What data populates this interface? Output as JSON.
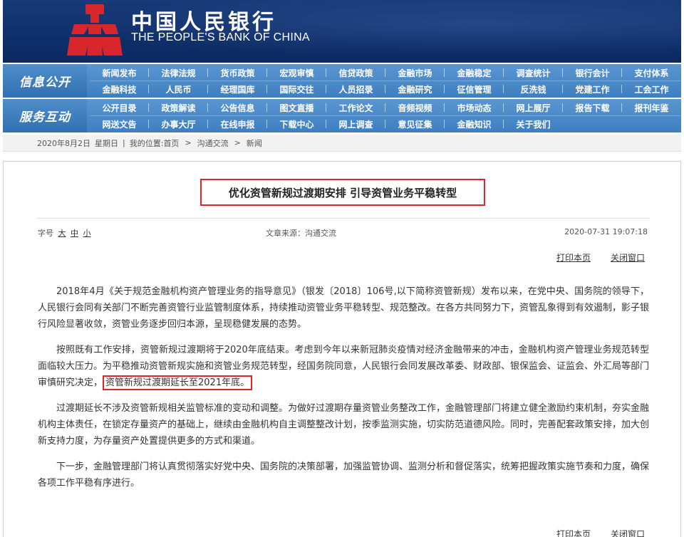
{
  "brand": {
    "name_cn": "中国人民银行",
    "name_en": "THE PEOPLE'S BANK OF CHINA",
    "emblem_color": "#d8262d"
  },
  "nav": [
    {
      "heading": "信息公开",
      "rows": [
        [
          "新闻发布",
          "法律法规",
          "货币政策",
          "宏观审慎",
          "信贷政策",
          "金融市场",
          "金融稳定",
          "调查统计",
          "银行会计",
          "支付体系"
        ],
        [
          "金融科技",
          "人民币",
          "经理国库",
          "国际交往",
          "人员招录",
          "金融研究",
          "征信管理",
          "反洗钱",
          "党建工作",
          "工会工作"
        ]
      ]
    },
    {
      "heading": "服务互动",
      "rows": [
        [
          "公开目录",
          "政策解读",
          "公告信息",
          "图文直播",
          "工作论文",
          "音频视频",
          "市场动态",
          "网上展厅",
          "报告下载",
          "报刊年鉴"
        ],
        [
          "网送文告",
          "办事大厅",
          "在线申报",
          "下载中心",
          "网上调查",
          "意见征集",
          "金融知识",
          "关于我们"
        ]
      ]
    }
  ],
  "breadcrumb": {
    "date": "2020年8月2日",
    "weekday": "星期日",
    "sep": "|",
    "location_label": "我的位置:",
    "home": "首页",
    "arrow": ">",
    "level1": "沟通交流",
    "level2": "新闻"
  },
  "article": {
    "title": "优化资管新规过渡期安排  引导资管业务平稳转型",
    "fontsize_label": "字号",
    "fontsize_options": [
      "大",
      "中",
      "小"
    ],
    "source": "文章来源：沟通交流",
    "datetime": "2020-07-31 19:07:18",
    "print_label": "打印本页",
    "close_label": "关闭窗口",
    "paragraphs": [
      "2018年4月《关于规范金融机构资产管理业务的指导意见》（银发〔2018〕106号,以下简称资管新规）发布以来，在党中央、国务院的领导下，人民银行会同有关部门不断完善资管行业监管制度体系，持续推动资管业务平稳转型、规范整改。在各方共同努力下，资管乱象得到有效遏制，影子银行风险显著收敛，资管业务逐步回归本源，呈现稳健发展的态势。",
      "过渡期延长不涉及资管新规相关监管标准的变动和调整。为做好过渡期存量资管业务整改工作，金融管理部门将建立健全激励约束机制，夯实金融机构主体责任，在锁定存量资产的基础上，继续由金融机构自主调整整改计划，按季监测实施，切实防范道德风险。同时，完善配套政策安排，加大创新支持力度，为存量资产处置提供更多的方式和渠道。",
      "下一步，金融管理部门将认真贯彻落实好党中央、国务院的决策部署，加强监管协调、监测分析和督促落实，统筹把握政策实施节奏和力度，确保各项工作平稳有序进行。"
    ],
    "para2_lead": "按照既有工作安排，资管新规过渡期将于2020年底结束。考虑到今年以来新冠肺炎疫情对经济金融带来的冲击，金融机构资产管理业务规范转型面临较大压力。为平稳推动资管新规实施和资管业务规范转型，经国务院同意，人民银行会同发展改革委、财政部、银保监会、证监会、外汇局等部门审慎研究决定，",
    "para2_highlight": "资管新规过渡期延长至2021年底。",
    "highlight_color": "#e0242a"
  }
}
